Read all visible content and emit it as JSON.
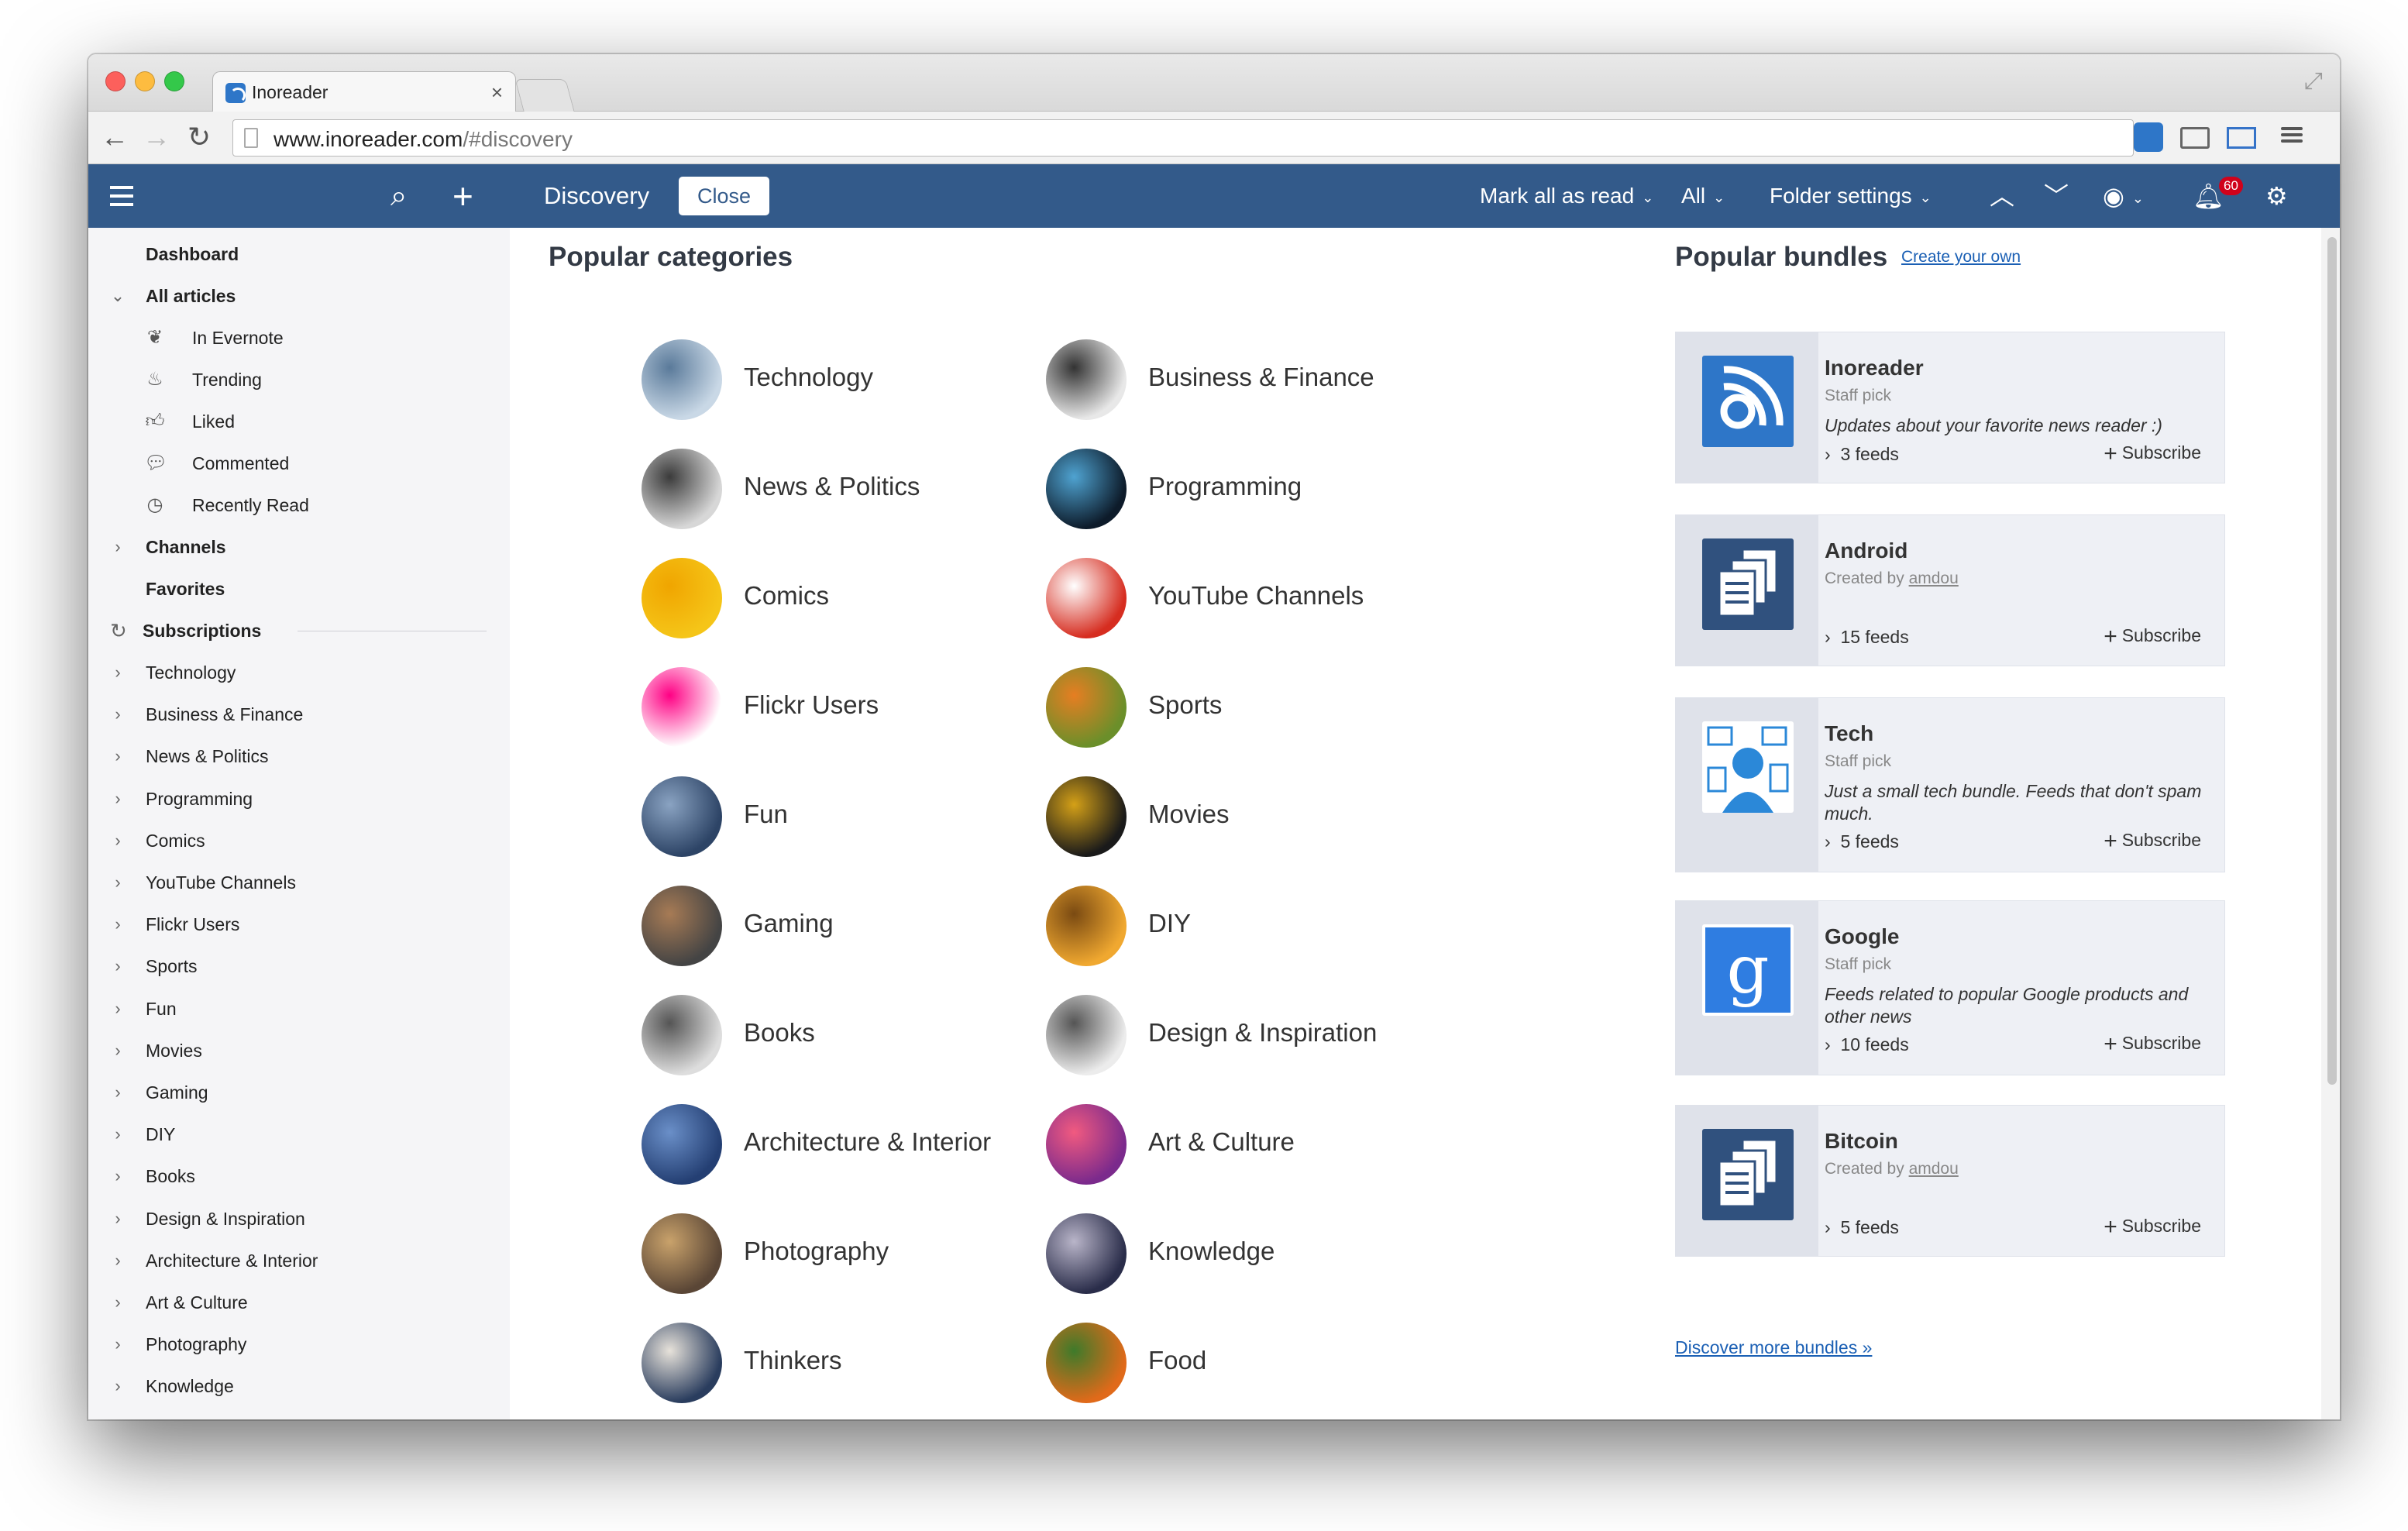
{
  "browser": {
    "tab_title": "Inoreader",
    "tab_close": "×",
    "url_host": "www.inoreader.com",
    "url_path": "/#discovery"
  },
  "appbar": {
    "section_title": "Discovery",
    "close_label": "Close",
    "mark_all_read": "Mark all as read",
    "filter_all": "All",
    "folder_settings": "Folder settings",
    "notifications_count": "60"
  },
  "sidebar": {
    "top": [
      {
        "label": "Dashboard"
      },
      {
        "label": "All articles"
      }
    ],
    "sub": [
      {
        "label": "In Evernote",
        "icon": "evernote-icon"
      },
      {
        "label": "Trending",
        "icon": "fire-icon"
      },
      {
        "label": "Liked",
        "icon": "thumbs-up-icon"
      },
      {
        "label": "Commented",
        "icon": "comment-icon"
      },
      {
        "label": "Recently Read",
        "icon": "history-icon"
      }
    ],
    "channels": "Channels",
    "favorites": "Favorites",
    "subscriptions": "Subscriptions",
    "folders": [
      "Technology",
      "Business & Finance",
      "News & Politics",
      "Programming",
      "Comics",
      "YouTube Channels",
      "Flickr Users",
      "Sports",
      "Fun",
      "Movies",
      "Gaming",
      "DIY",
      "Books",
      "Design & Inspiration",
      "Architecture & Interior",
      "Art & Culture",
      "Photography",
      "Knowledge"
    ]
  },
  "categories": {
    "heading": "Popular categories",
    "left": [
      "Technology",
      "News & Politics",
      "Comics",
      "Flickr Users",
      "Fun",
      "Gaming",
      "Books",
      "Architecture & Interior",
      "Photography",
      "Thinkers"
    ],
    "right": [
      "Business & Finance",
      "Programming",
      "YouTube Channels",
      "Sports",
      "Movies",
      "DIY",
      "Design & Inspiration",
      "Art & Culture",
      "Knowledge",
      "Food"
    ]
  },
  "bundles": {
    "heading": "Popular bundles",
    "create_link": "Create your own",
    "subscribe_label": "Subscribe",
    "more_link": "Discover more bundles »",
    "created_by_prefix": "Created by",
    "items": [
      {
        "title": "Inoreader",
        "meta": "Staff pick",
        "desc": "Updates about your favorite news reader :)",
        "feeds": "3 feeds"
      },
      {
        "title": "Android",
        "meta_author": "amdou",
        "desc": "",
        "feeds": "15 feeds"
      },
      {
        "title": "Tech",
        "meta": "Staff pick",
        "desc": "Just a small tech bundle. Feeds that don't spam much.",
        "feeds": "5 feeds"
      },
      {
        "title": "Google",
        "meta": "Staff pick",
        "desc": "Feeds related to popular Google products and other news",
        "feeds": "10 feeds"
      },
      {
        "title": "Bitcoin",
        "meta_author": "amdou",
        "desc": "",
        "feeds": "5 feeds"
      }
    ]
  },
  "colors": {
    "header": "#335a8a",
    "link": "#1a5fb4",
    "sidebar_bg": "#f5f5f7",
    "bundle_bg": "#eef0f5"
  }
}
